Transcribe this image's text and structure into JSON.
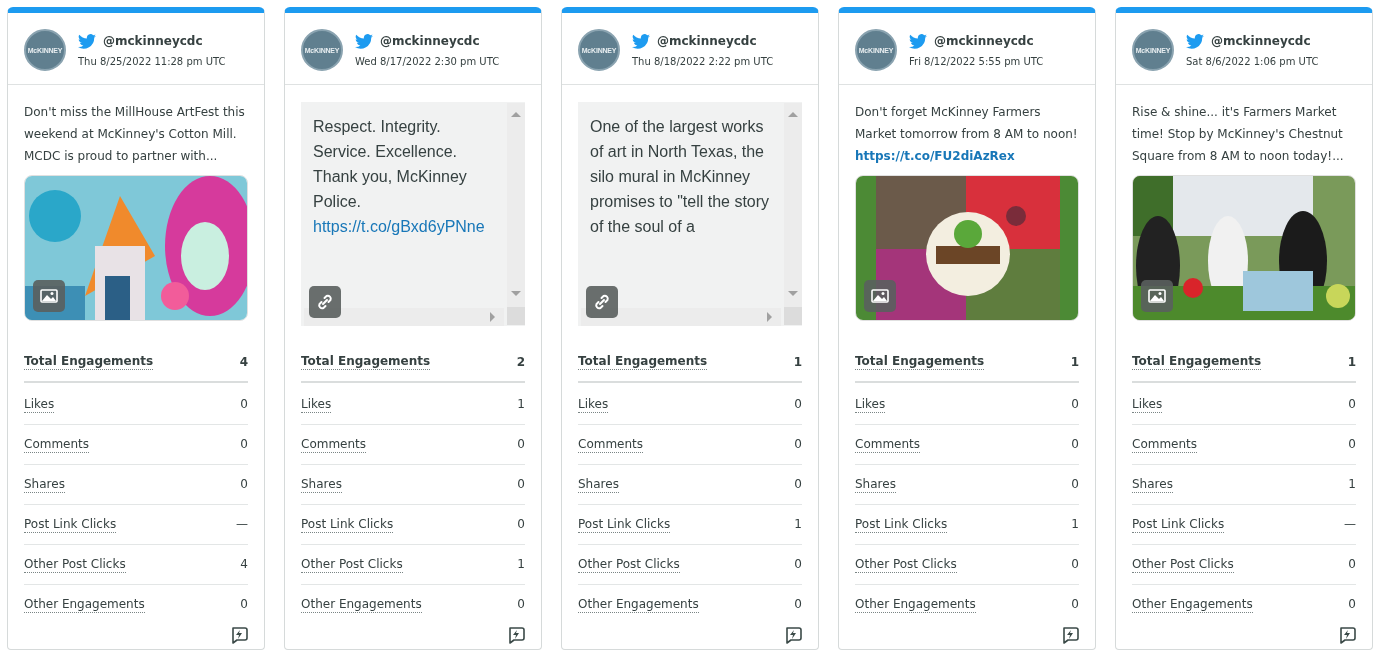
{
  "cards": [
    {
      "avatar_text": "McKINNEY",
      "handle": "@mckinneycdc",
      "timestamp": "Thu 8/25/2022 11:28 pm UTC",
      "text": "Don't miss the MillHouse ArtFest this weekend at McKinney's Cotton Mill. MCDC is proud to partner with...",
      "metrics": [
        {
          "kind": "total",
          "label": "Total Engagements",
          "value": "4"
        },
        {
          "kind": "metric",
          "label": "Likes",
          "value": "0"
        },
        {
          "kind": "metric",
          "label": "Comments",
          "value": "0"
        },
        {
          "kind": "metric",
          "label": "Shares",
          "value": "0"
        },
        {
          "kind": "metric",
          "label": "Post Link Clicks",
          "value": "—"
        },
        {
          "kind": "metric",
          "label": "Other Post Clicks",
          "value": "4"
        },
        {
          "kind": "metric",
          "label": "Other Engagements",
          "value": "0"
        }
      ]
    },
    {
      "avatar_text": "McKINNEY",
      "handle": "@mckinneycdc",
      "timestamp": "Wed 8/17/2022 2:30 pm UTC",
      "kind": "link",
      "text": "Respect. Integrity. Service. Excellence. Thank you, McKinney Police.",
      "link": "https://t.co/gBxd6yPNne",
      "metrics": [
        {
          "kind": "total",
          "label": "Total Engagements",
          "value": "2"
        },
        {
          "kind": "metric",
          "label": "Likes",
          "value": "1"
        },
        {
          "kind": "metric",
          "label": "Comments",
          "value": "0"
        },
        {
          "kind": "metric",
          "label": "Shares",
          "value": "0"
        },
        {
          "kind": "metric",
          "label": "Post Link Clicks",
          "value": "0"
        },
        {
          "kind": "metric",
          "label": "Other Post Clicks",
          "value": "1"
        },
        {
          "kind": "metric",
          "label": "Other Engagements",
          "value": "0"
        }
      ]
    },
    {
      "avatar_text": "McKINNEY",
      "handle": "@mckinneycdc",
      "timestamp": "Thu 8/18/2022 2:22 pm UTC",
      "kind": "link",
      "text": "One of the largest works of art in North Texas, the silo mural in McKinney promises to \"tell the story of the soul of a",
      "metrics": [
        {
          "kind": "total",
          "label": "Total Engagements",
          "value": "1"
        },
        {
          "kind": "metric",
          "label": "Likes",
          "value": "0"
        },
        {
          "kind": "metric",
          "label": "Comments",
          "value": "0"
        },
        {
          "kind": "metric",
          "label": "Shares",
          "value": "0"
        },
        {
          "kind": "metric",
          "label": "Post Link Clicks",
          "value": "1"
        },
        {
          "kind": "metric",
          "label": "Other Post Clicks",
          "value": "0"
        },
        {
          "kind": "metric",
          "label": "Other Engagements",
          "value": "0"
        }
      ]
    },
    {
      "avatar_text": "McKINNEY",
      "handle": "@mckinneycdc",
      "timestamp": "Fri 8/12/2022 5:55 pm UTC",
      "text": "Don't forget McKinney Farmers Market tomorrow from 8 AM to noon!",
      "link": "https://t.co/FU2diAzRex",
      "metrics": [
        {
          "kind": "total",
          "label": "Total Engagements",
          "value": "1"
        },
        {
          "kind": "metric",
          "label": "Likes",
          "value": "0"
        },
        {
          "kind": "metric",
          "label": "Comments",
          "value": "0"
        },
        {
          "kind": "metric",
          "label": "Shares",
          "value": "0"
        },
        {
          "kind": "metric",
          "label": "Post Link Clicks",
          "value": "1"
        },
        {
          "kind": "metric",
          "label": "Other Post Clicks",
          "value": "0"
        },
        {
          "kind": "metric",
          "label": "Other Engagements",
          "value": "0"
        }
      ]
    },
    {
      "avatar_text": "McKINNEY",
      "handle": "@mckinneycdc",
      "timestamp": "Sat 8/6/2022 1:06 pm UTC",
      "text": "Rise & shine... it's Farmers Market time! Stop by McKinney's Chestnut Square from 8 AM to noon today!...",
      "metrics": [
        {
          "kind": "total",
          "label": "Total Engagements",
          "value": "1"
        },
        {
          "kind": "metric",
          "label": "Likes",
          "value": "0"
        },
        {
          "kind": "metric",
          "label": "Comments",
          "value": "0"
        },
        {
          "kind": "metric",
          "label": "Shares",
          "value": "1"
        },
        {
          "kind": "metric",
          "label": "Post Link Clicks",
          "value": "—"
        },
        {
          "kind": "metric",
          "label": "Other Post Clicks",
          "value": "0"
        },
        {
          "kind": "metric",
          "label": "Other Engagements",
          "value": "0"
        }
      ]
    }
  ]
}
